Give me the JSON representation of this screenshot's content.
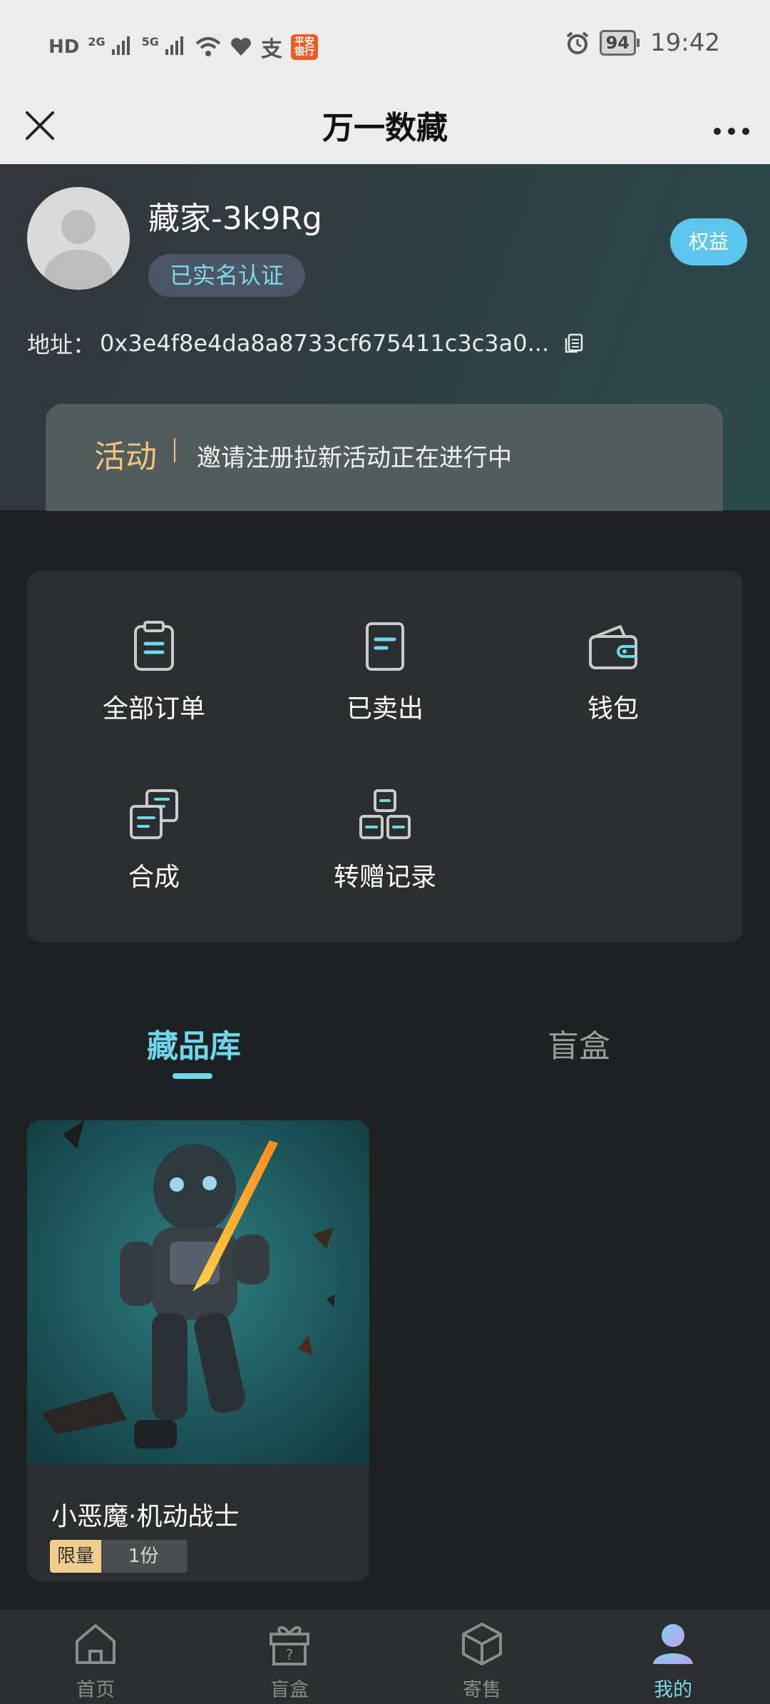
{
  "status_bar": {
    "left_labels": [
      "HD",
      "2G",
      "5G"
    ],
    "app_badge": "平安银行",
    "alipay": "支",
    "battery": "94",
    "time": "19:42"
  },
  "titlebar": {
    "title": "万一数藏"
  },
  "profile": {
    "username": "藏家-3k9Rg",
    "verified_label": "已实名认证",
    "rights_button": "权益",
    "address_label": "地址：",
    "address_value": "0x3e4f8e4da8a8733cf675411c3c3a0..."
  },
  "activity": {
    "tag": "活动",
    "text": "邀请注册拉新活动正在进行中"
  },
  "menu": {
    "items": [
      {
        "label": "全部订单",
        "icon": "clipboard-icon"
      },
      {
        "label": "已卖出",
        "icon": "document-icon"
      },
      {
        "label": "钱包",
        "icon": "wallet-icon"
      },
      {
        "label": "合成",
        "icon": "stacked-docs-icon"
      },
      {
        "label": "转赠记录",
        "icon": "boxes-icon"
      }
    ]
  },
  "tabs": {
    "collection": "藏品库",
    "blind_box": "盲盒"
  },
  "collection": {
    "items": [
      {
        "title": "小恶魔·机动战士",
        "limit_tag": "限量",
        "count": "1份"
      }
    ]
  },
  "bottom_nav": {
    "items": [
      {
        "label": "首页",
        "icon": "home-icon"
      },
      {
        "label": "盲盒",
        "icon": "gift-icon"
      },
      {
        "label": "寄售",
        "icon": "cube-icon"
      },
      {
        "label": "我的",
        "icon": "user-icon"
      }
    ]
  },
  "colors": {
    "accent": "#6fd6ec",
    "activity_tag": "#f2c57c",
    "rights_button": "#5ec6ee",
    "limit_tag": "#f2cd8e"
  }
}
